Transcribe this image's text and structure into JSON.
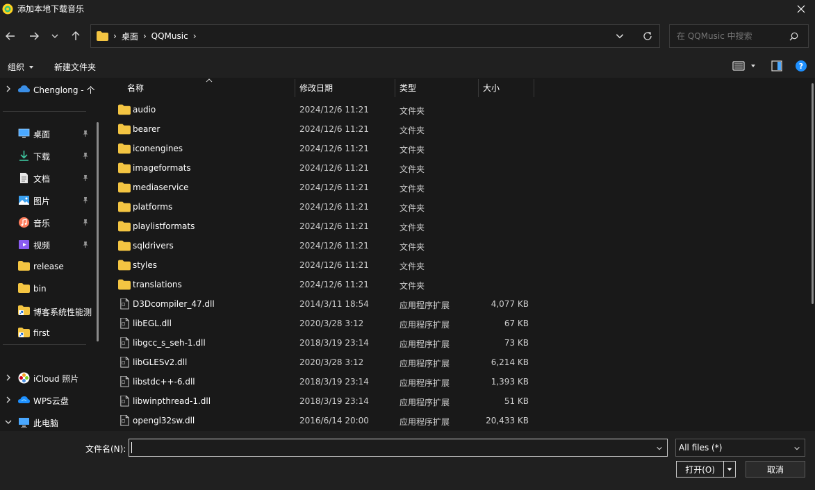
{
  "window": {
    "title": "添加本地下载音乐",
    "app_icon": "qqmusic-logo-icon",
    "close_icon": "close-icon"
  },
  "nav": {
    "breadcrumb": [
      "桌面",
      "QQMusic"
    ],
    "search_placeholder": "在 QQMusic 中搜索"
  },
  "toolbar": {
    "organize_label": "组织",
    "new_folder_label": "新建文件夹"
  },
  "sidebar": {
    "items": [
      {
        "label": "Chenglong - 个",
        "icon": "onedrive-cloud-icon",
        "chevron": true,
        "pinned": false
      },
      {
        "label": "桌面",
        "icon": "desktop-icon",
        "chevron": false,
        "pinned": true
      },
      {
        "label": "下载",
        "icon": "download-icon",
        "chevron": false,
        "pinned": true
      },
      {
        "label": "文档",
        "icon": "document-icon",
        "chevron": false,
        "pinned": true
      },
      {
        "label": "图片",
        "icon": "picture-icon",
        "chevron": false,
        "pinned": true
      },
      {
        "label": "音乐",
        "icon": "music-icon",
        "chevron": false,
        "pinned": true
      },
      {
        "label": "视频",
        "icon": "video-icon",
        "chevron": false,
        "pinned": true
      },
      {
        "label": "release",
        "icon": "folder-icon",
        "chevron": false,
        "pinned": false
      },
      {
        "label": "bin",
        "icon": "folder-icon",
        "chevron": false,
        "pinned": false
      },
      {
        "label": "博客系统性能测",
        "icon": "folder-shortcut-icon",
        "chevron": false,
        "pinned": false
      },
      {
        "label": "first",
        "icon": "folder-shortcut-icon",
        "chevron": false,
        "pinned": false
      },
      {
        "label": "iCloud 照片",
        "icon": "icloud-photos-icon",
        "chevron": true,
        "pinned": false
      },
      {
        "label": "WPS云盘",
        "icon": "wps-cloud-icon",
        "chevron": true,
        "pinned": false
      },
      {
        "label": "此电脑",
        "icon": "this-pc-icon",
        "chevron": true,
        "pinned": false
      }
    ]
  },
  "columns": {
    "name": "名称",
    "date": "修改日期",
    "type": "类型",
    "size": "大小"
  },
  "files": [
    {
      "name": "audio",
      "date": "2024/12/6 11:21",
      "type": "文件夹",
      "size": "",
      "icon": "folder-icon"
    },
    {
      "name": "bearer",
      "date": "2024/12/6 11:21",
      "type": "文件夹",
      "size": "",
      "icon": "folder-icon"
    },
    {
      "name": "iconengines",
      "date": "2024/12/6 11:21",
      "type": "文件夹",
      "size": "",
      "icon": "folder-icon"
    },
    {
      "name": "imageformats",
      "date": "2024/12/6 11:21",
      "type": "文件夹",
      "size": "",
      "icon": "folder-icon"
    },
    {
      "name": "mediaservice",
      "date": "2024/12/6 11:21",
      "type": "文件夹",
      "size": "",
      "icon": "folder-icon"
    },
    {
      "name": "platforms",
      "date": "2024/12/6 11:21",
      "type": "文件夹",
      "size": "",
      "icon": "folder-icon"
    },
    {
      "name": "playlistformats",
      "date": "2024/12/6 11:21",
      "type": "文件夹",
      "size": "",
      "icon": "folder-icon"
    },
    {
      "name": "sqldrivers",
      "date": "2024/12/6 11:21",
      "type": "文件夹",
      "size": "",
      "icon": "folder-icon"
    },
    {
      "name": "styles",
      "date": "2024/12/6 11:21",
      "type": "文件夹",
      "size": "",
      "icon": "folder-icon"
    },
    {
      "name": "translations",
      "date": "2024/12/6 11:21",
      "type": "文件夹",
      "size": "",
      "icon": "folder-icon"
    },
    {
      "name": "D3Dcompiler_47.dll",
      "date": "2014/3/11 18:54",
      "type": "应用程序扩展",
      "size": "4,077 KB",
      "icon": "dll-file-icon"
    },
    {
      "name": "libEGL.dll",
      "date": "2020/3/28 3:12",
      "type": "应用程序扩展",
      "size": "67 KB",
      "icon": "dll-file-icon"
    },
    {
      "name": "libgcc_s_seh-1.dll",
      "date": "2018/3/19 23:14",
      "type": "应用程序扩展",
      "size": "73 KB",
      "icon": "dll-file-icon"
    },
    {
      "name": "libGLESv2.dll",
      "date": "2020/3/28 3:12",
      "type": "应用程序扩展",
      "size": "6,214 KB",
      "icon": "dll-file-icon"
    },
    {
      "name": "libstdc++-6.dll",
      "date": "2018/3/19 23:14",
      "type": "应用程序扩展",
      "size": "1,393 KB",
      "icon": "dll-file-icon"
    },
    {
      "name": "libwinpthread-1.dll",
      "date": "2018/3/19 23:14",
      "type": "应用程序扩展",
      "size": "51 KB",
      "icon": "dll-file-icon"
    },
    {
      "name": "opengl32sw.dll",
      "date": "2016/6/14 20:00",
      "type": "应用程序扩展",
      "size": "20,433 KB",
      "icon": "dll-file-icon"
    }
  ],
  "bottom": {
    "filename_label": "文件名(N):",
    "filename_value": "",
    "filter_label": "All files  (*)",
    "open_label": "打开(O)",
    "cancel_label": "取消"
  },
  "colors": {
    "background": "#191919",
    "chrome": "#202020",
    "folder": "#f4c542",
    "accent": "#0a84ff"
  }
}
